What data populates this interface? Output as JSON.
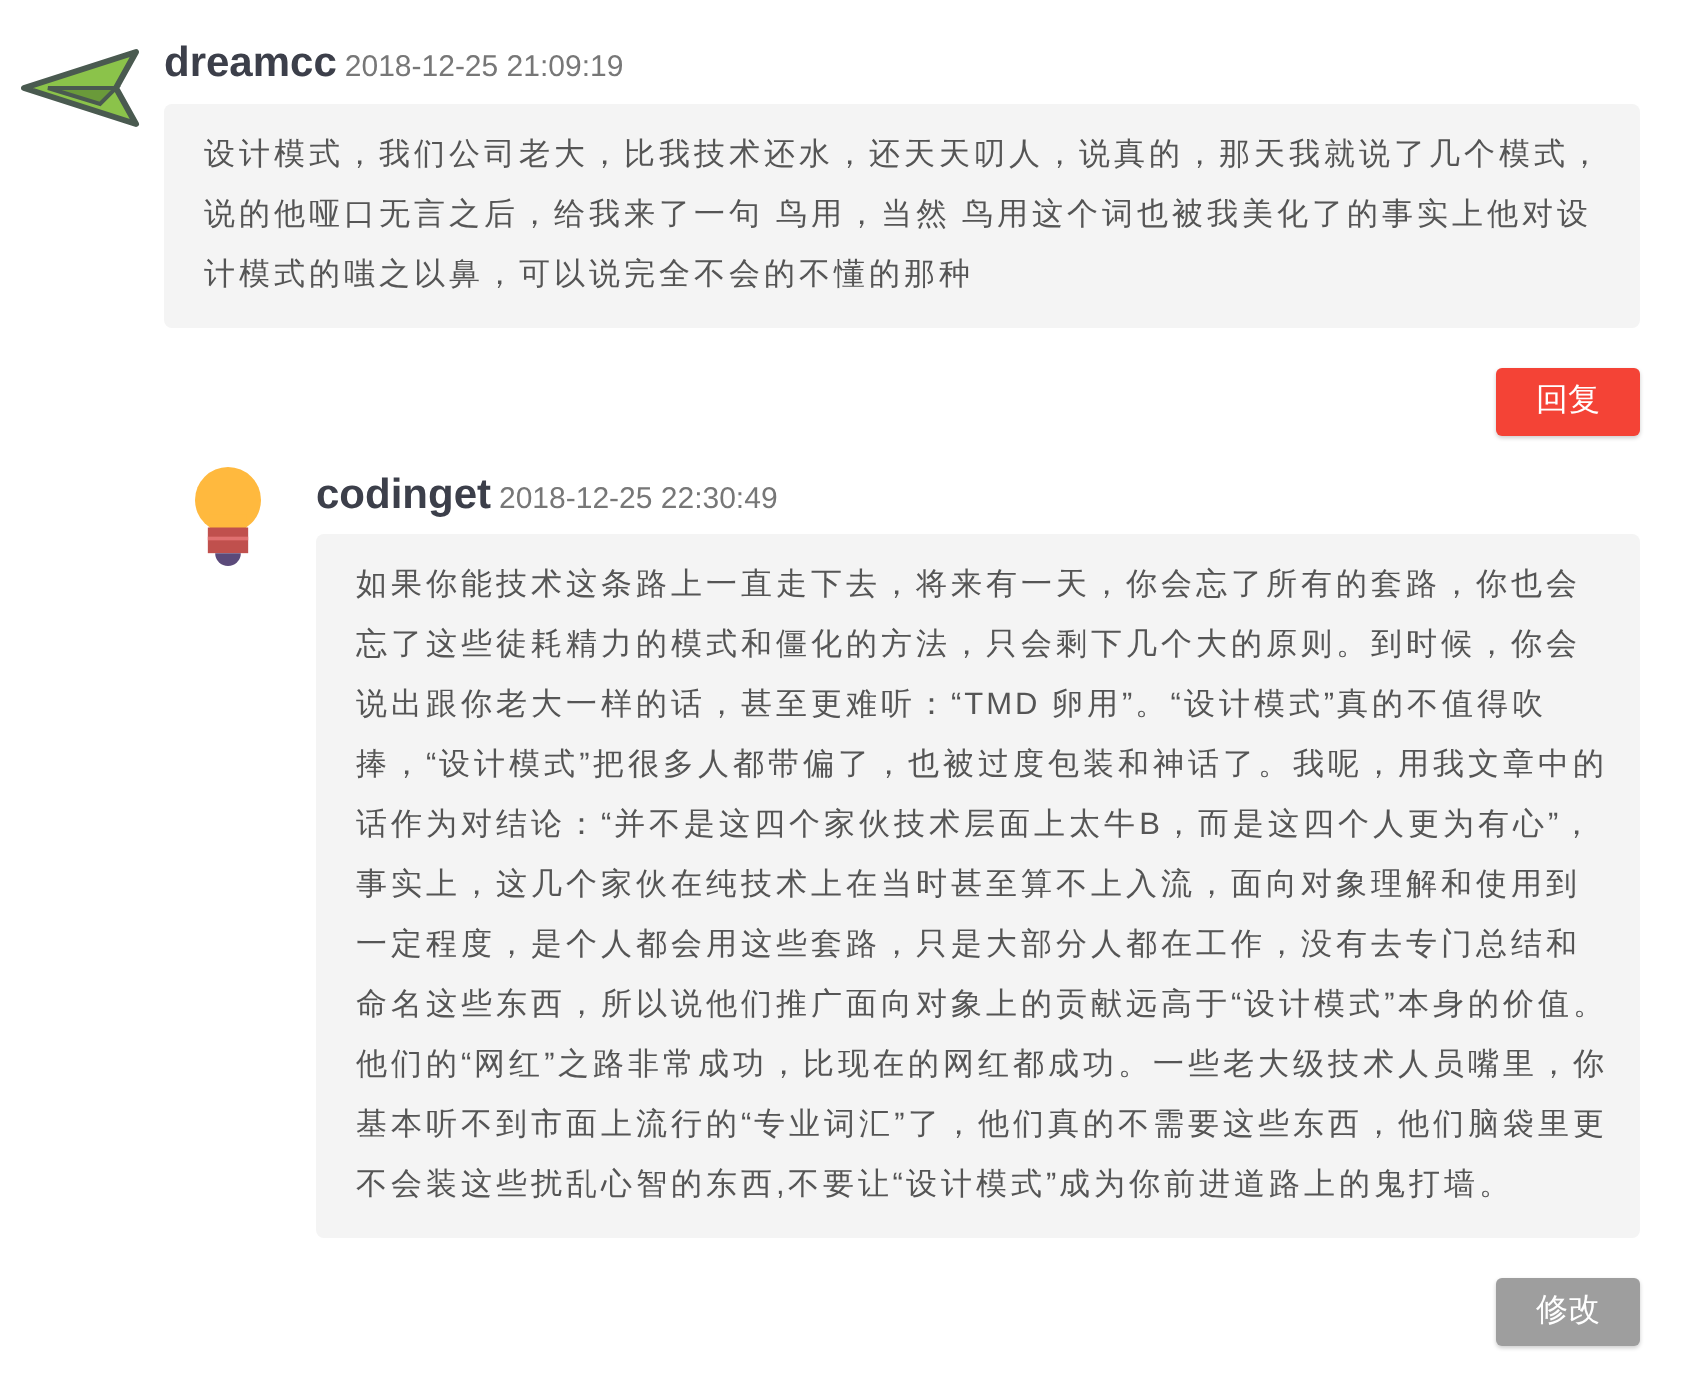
{
  "comments": [
    {
      "avatar": {
        "kind": "arrow"
      },
      "author": "dreamcc",
      "time": "2018-12-25 21:09:19",
      "text": "设计模式，我们公司老大，比我技术还水，还天天叨人，说真的，那天我就说了几个模式，说的他哑口无言之后，给我来了一句 鸟用，当然 鸟用这个词也被我美化了的事实上他对设计模式的嗤之以鼻，可以说完全不会的不懂的那种",
      "action": {
        "kind": "reply",
        "label": "回复"
      },
      "replies": [
        {
          "avatar": {
            "kind": "bulb"
          },
          "author": "codinget",
          "time": "2018-12-25 22:30:49",
          "text": "如果你能技术这条路上一直走下去，将来有一天，你会忘了所有的套路，你也会忘了这些徒耗精力的模式和僵化的方法，只会剩下几个大的原则。到时候，你会说出跟你老大一样的话，甚至更难听：“TMD 卵用”。“设计模式”真的不值得吹捧，“设计模式”把很多人都带偏了，也被过度包装和神话了。我呢，用我文章中的话作为对结论：“并不是这四个家伙技术层面上太牛B，而是这四个人更为有心”，事实上，这几个家伙在纯技术上在当时甚至算不上入流，面向对象理解和使用到一定程度，是个人都会用这些套路，只是大部分人都在工作，没有去专门总结和命名这些东西，所以说他们推广面向对象上的贡献远高于“设计模式”本身的价值。他们的“网红”之路非常成功，比现在的网红都成功。一些老大级技术人员嘴里，你基本听不到市面上流行的“专业词汇”了，他们真的不需要这些东西，他们脑袋里更不会装这些扰乱心智的东西,不要让“设计模式”成为你前进道路上的鬼打墙。",
          "action": {
            "kind": "edit",
            "label": "修改"
          }
        }
      ]
    }
  ]
}
